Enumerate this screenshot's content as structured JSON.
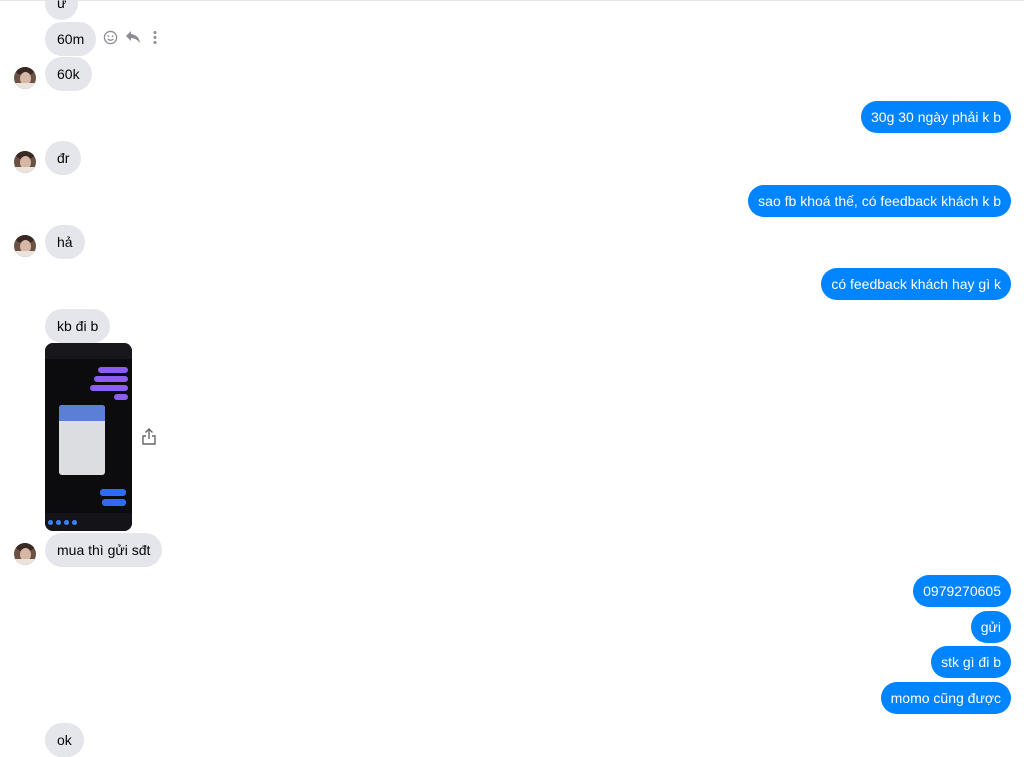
{
  "incoming": {
    "m0": "ừ",
    "m1": "60m",
    "m2": "60k",
    "m3": "đr",
    "m4": "hả",
    "m5": "kb đi b",
    "m6": "mua thì gửi sđt",
    "m7": "ok"
  },
  "outgoing": {
    "o1": "30g 30 ngày phải k b",
    "o2": "sao fb khoá thế, có feedback khách k b",
    "o3": "có feedback khách hay gì k",
    "o4": "0979270605",
    "o5": "gửi",
    "o6": "stk gì đi b",
    "o7": "momo cũng được"
  },
  "icons": {
    "react": "smile-icon",
    "reply": "reply-icon",
    "more": "more-vertical-icon",
    "share": "share-icon"
  },
  "colors": {
    "incoming_bubble": "#e4e6eb",
    "outgoing_bubble": "#0084ff"
  }
}
